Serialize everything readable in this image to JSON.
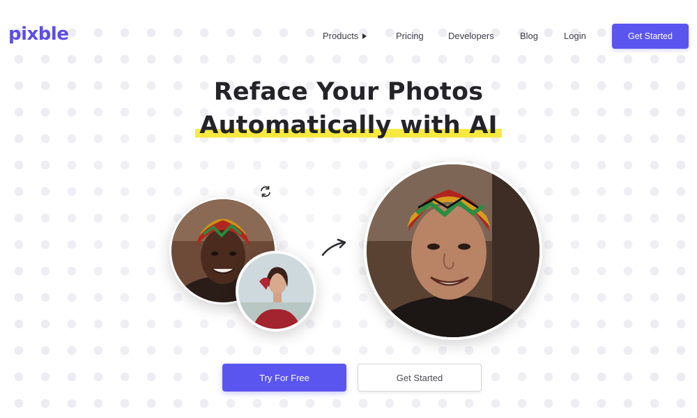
{
  "brand": {
    "name": "pixble",
    "color": "#5b4ee6"
  },
  "nav": {
    "items": [
      "Products",
      "Pricing",
      "Developers",
      "Blog",
      "Login"
    ],
    "products_caret_icon": "caret-right-icon",
    "cta_label": "Get Started"
  },
  "hero": {
    "title_line1": "Reface Your Photos",
    "title_line2": "Automatically with AI",
    "highlight_color": "#f7e93f"
  },
  "visual": {
    "swap_icon": "refresh-swap-icon",
    "arrow_icon": "curved-arrow-right-icon",
    "photos": [
      "source-face-photo",
      "target-photo",
      "result-photo"
    ]
  },
  "actions": {
    "primary_label": "Try For Free",
    "secondary_label": "Get Started",
    "accent_color": "#5b55f0"
  }
}
